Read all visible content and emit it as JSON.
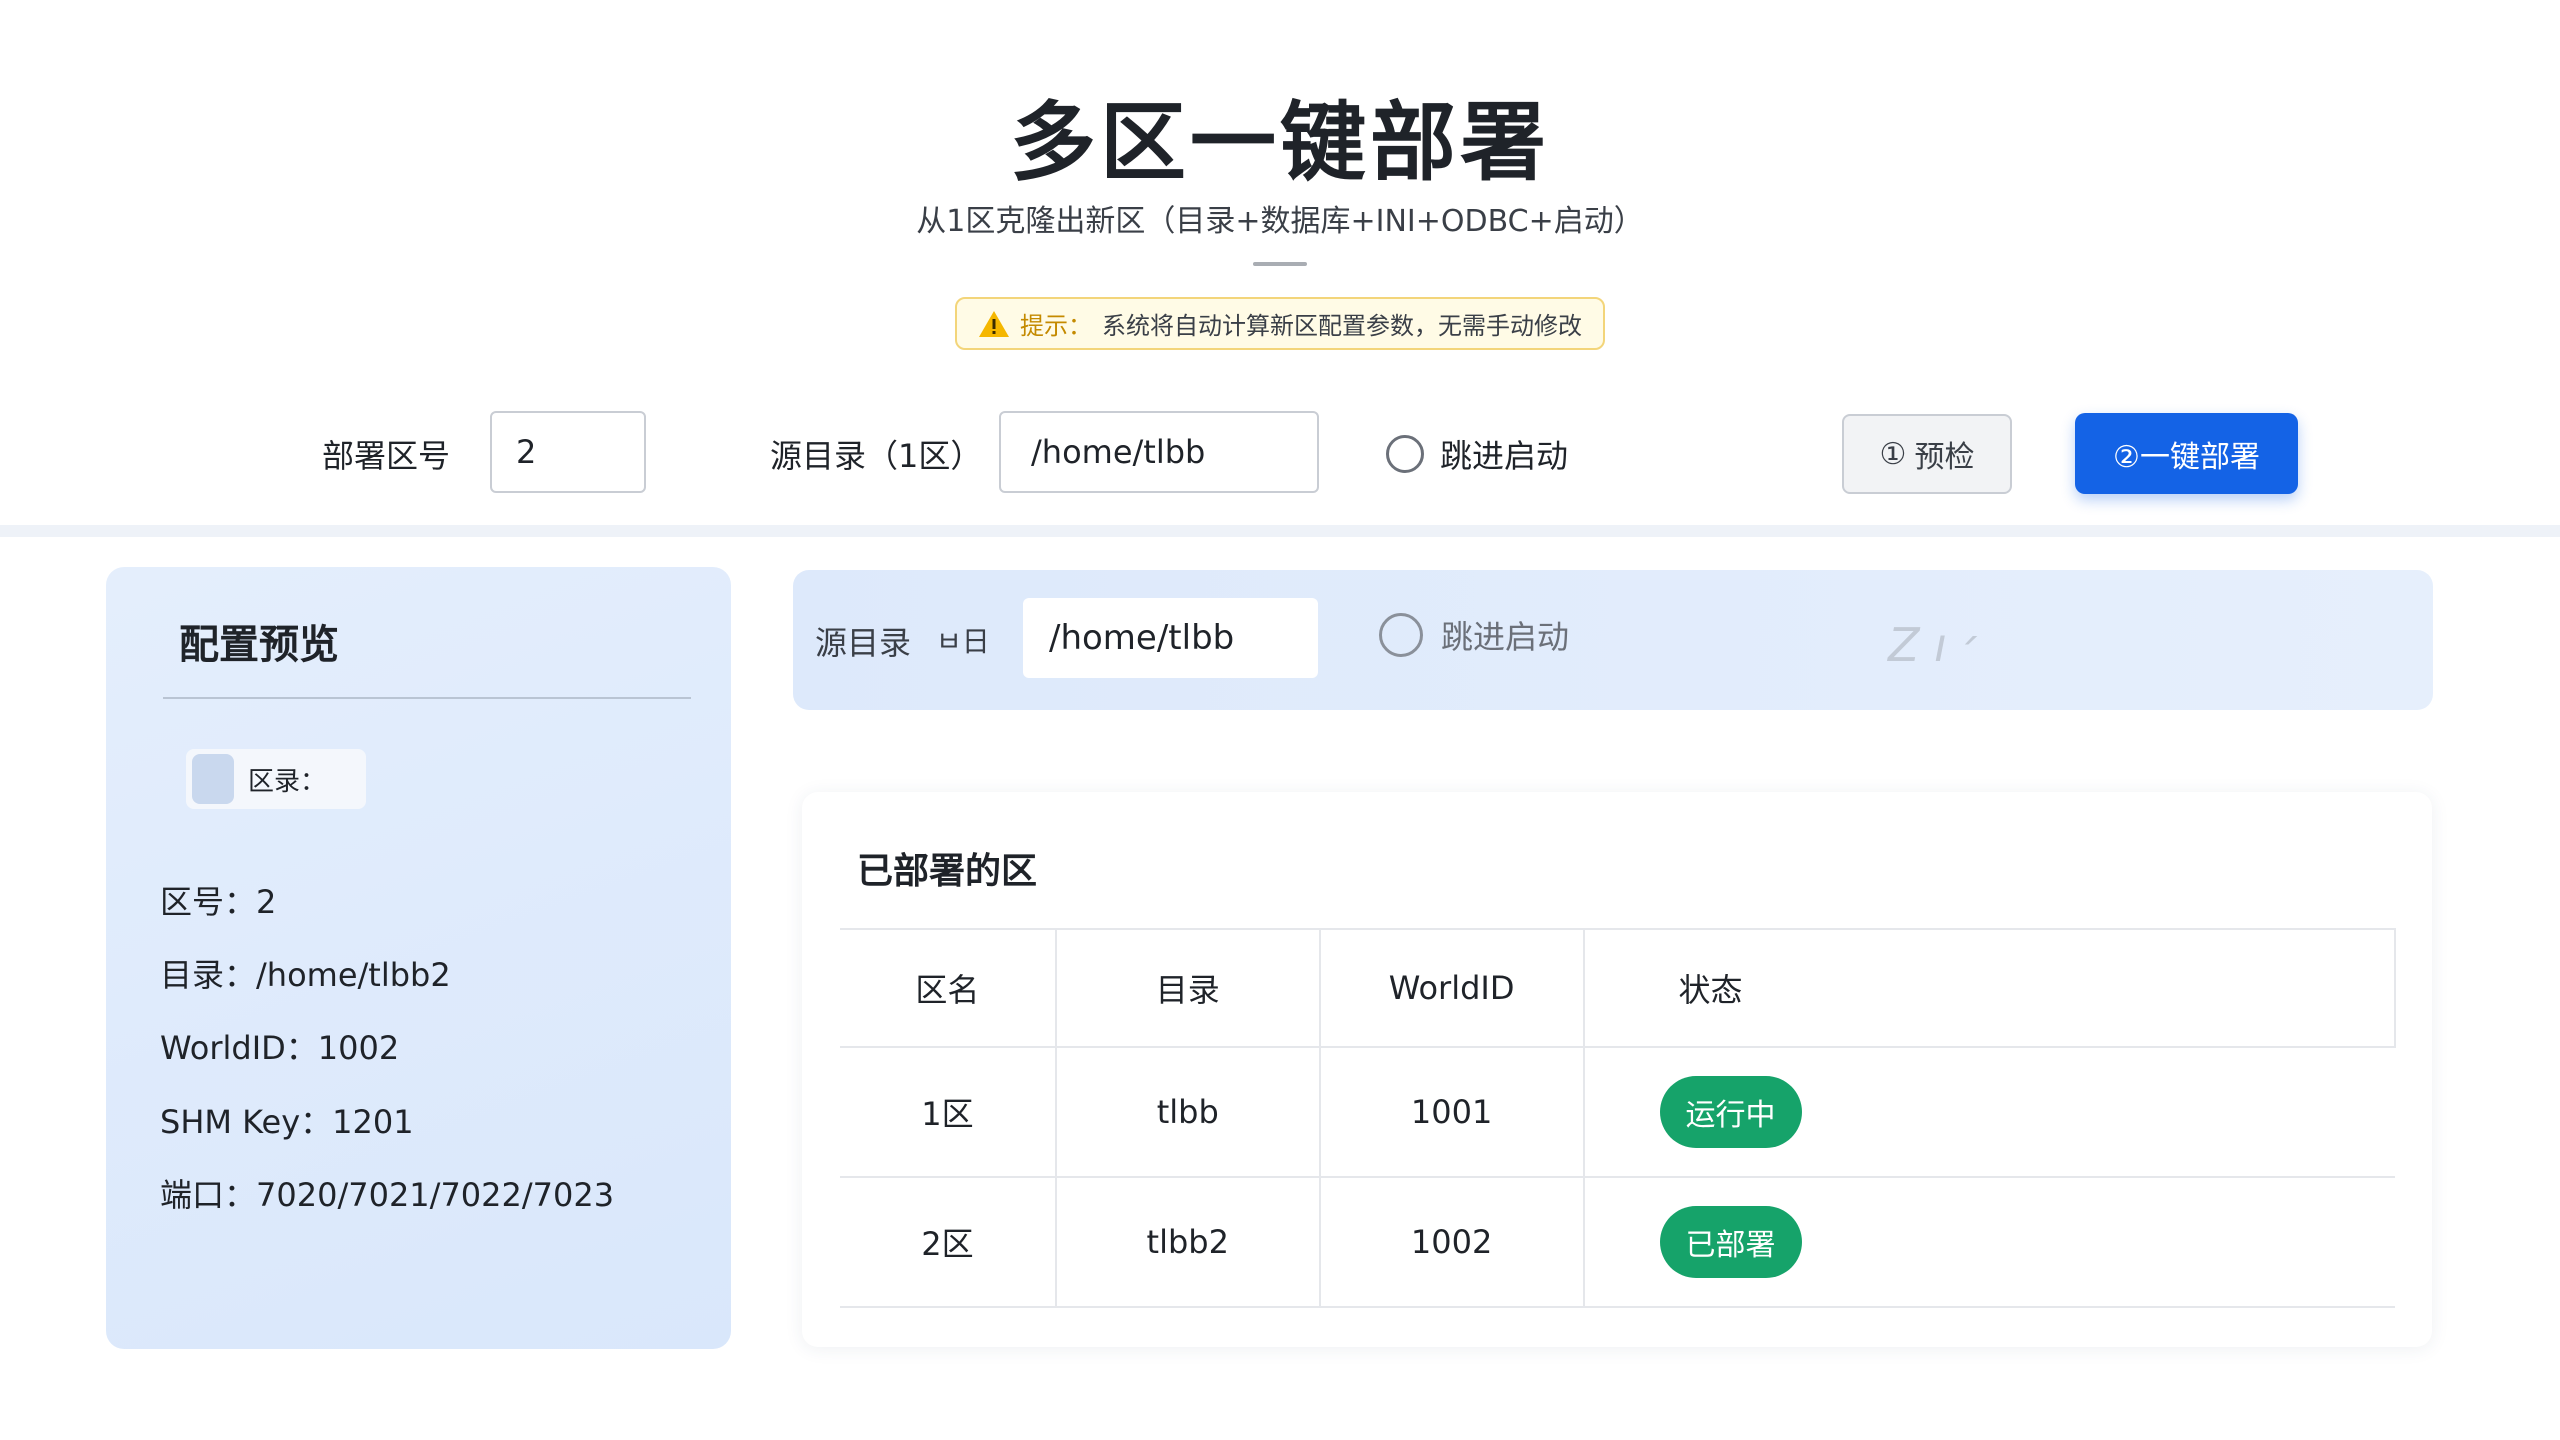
{
  "header": {
    "title": "多区一键部署",
    "subtitle": "从1区克隆出新区（目录+数据库+INI+ODBC+启动）",
    "tip_label": "提示：",
    "tip_text": "系统将自动计算新区配置参数，无需手动修改"
  },
  "toolbar": {
    "zone_label": "部署区号",
    "zone_value": "2",
    "source_label": "源目录（1区）",
    "source_value": "/home/tlbb",
    "skip_start_label": "跳进启动",
    "check_button": "预检",
    "check_num": "①",
    "deploy_button": "②一键部署"
  },
  "preview": {
    "title": "配置预览",
    "chip_label": "区录：",
    "zone": "区号：2",
    "dir": "目录：/home/tlbb2",
    "world_id": "WorldID：1002",
    "shm_key": "SHM Key：1201",
    "ports": "端口：7020/7021/7022/7023"
  },
  "source_bar": {
    "label": "源目录",
    "mini": "ㅂ日",
    "value": "/home/tlbb",
    "skip_start_label": "跳进启动",
    "faint_mark": "Z ı ׳"
  },
  "deployed": {
    "title": "已部署的区",
    "columns": [
      "区名",
      "目录",
      "WorldID",
      "状态"
    ],
    "rows": [
      {
        "name": "1区",
        "dir": "tlbb",
        "world_id": "1001",
        "status": "运行中"
      },
      {
        "name": "2区",
        "dir": "tlbb2",
        "world_id": "1002",
        "status": "已部署"
      }
    ]
  },
  "colors": {
    "primary": "#1463e6",
    "success": "#16a36a",
    "warning": "#c48a00",
    "panel": "#dde9fb"
  }
}
